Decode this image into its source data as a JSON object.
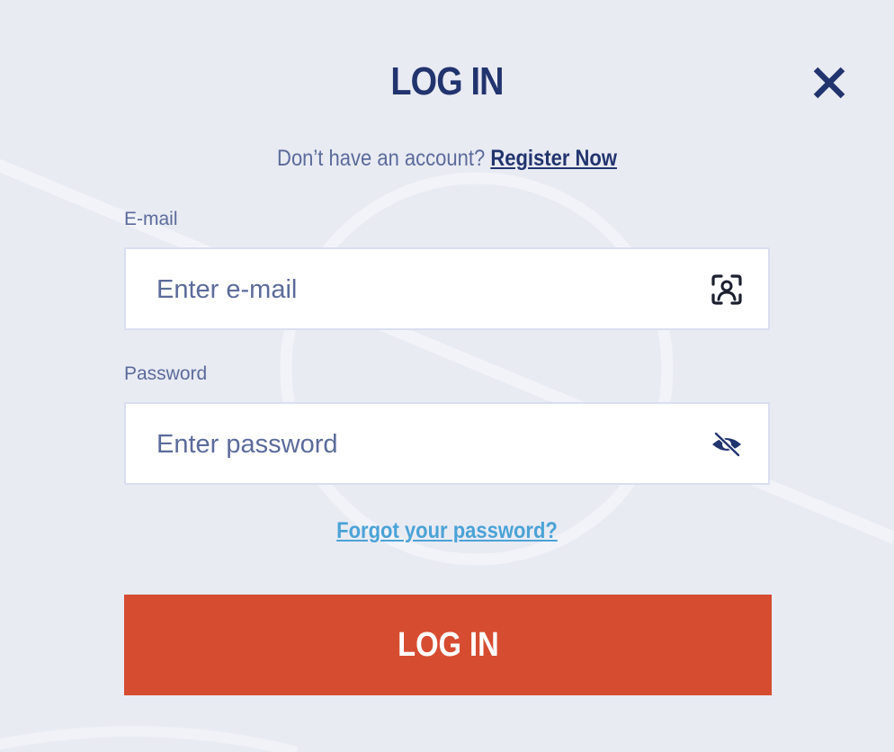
{
  "modal": {
    "title": "LOG IN",
    "close_icon": "close-icon"
  },
  "register": {
    "prompt": "Don’t have an account?",
    "link_label": "Register Now"
  },
  "email": {
    "label": "E-mail",
    "placeholder": "Enter e-mail",
    "value": "",
    "icon": "user-scan-icon"
  },
  "password": {
    "label": "Password",
    "placeholder": "Enter password",
    "value": "",
    "icon": "eye-slash-icon"
  },
  "forgot_link": "Forgot your password?",
  "submit_label": "LOG IN",
  "colors": {
    "background": "#e9ebf3",
    "primary_text": "#22346e",
    "secondary_text": "#5b6b9a",
    "link": "#4aa3d6",
    "button": "#d64c31",
    "input_border": "#d9dff0"
  }
}
